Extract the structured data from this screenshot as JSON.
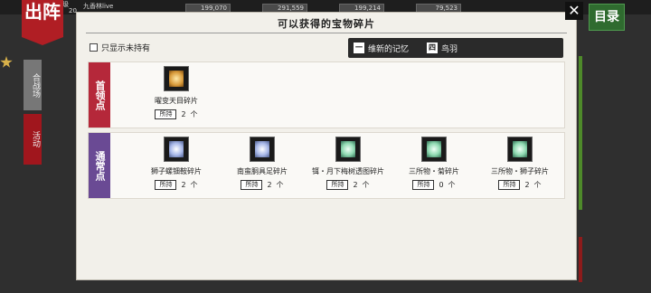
{
  "background": {
    "sortie_label": "出阵",
    "level_label": "等级",
    "level_value": "20",
    "player_name": "九香林live",
    "resources": [
      "199,070",
      "291,559",
      "199,214",
      "79,523"
    ],
    "tabs": [
      "合战场",
      "活动"
    ],
    "menu_label": "目录"
  },
  "modal": {
    "title": "可以获得的宝物碎片",
    "close_icon": "close-icon",
    "filter_label": "只显示未持有",
    "legend": [
      {
        "tag": "一",
        "text": "维新的记忆"
      },
      {
        "tag": "四",
        "text": "鸟羽"
      }
    ],
    "sections": [
      {
        "label": "首领点",
        "color": "#b5283a",
        "items": [
          {
            "name": "曜变天目碎片",
            "own_label": "所持",
            "count": "2",
            "unit": "个",
            "icon": "gold-fragment-icon"
          }
        ]
      },
      {
        "label": "通常点",
        "color": "#6a4a94",
        "items": [
          {
            "name": "狮子螺钿鞍碎片",
            "own_label": "所持",
            "count": "2",
            "unit": "个",
            "icon": "blue-fragment-icon"
          },
          {
            "name": "南蛮胴具足碎片",
            "own_label": "所持",
            "count": "2",
            "unit": "个",
            "icon": "blue-fragment-icon"
          },
          {
            "name": "铒・月下梅树透图碎片",
            "own_label": "所持",
            "count": "2",
            "unit": "个",
            "icon": "teal-fragment-icon"
          },
          {
            "name": "三所物・菊碎片",
            "own_label": "所持",
            "count": "0",
            "unit": "个",
            "icon": "teal-fragment-icon"
          },
          {
            "name": "三所物・狮子碎片",
            "own_label": "所持",
            "count": "2",
            "unit": "个",
            "icon": "teal-fragment-icon"
          }
        ]
      }
    ]
  }
}
